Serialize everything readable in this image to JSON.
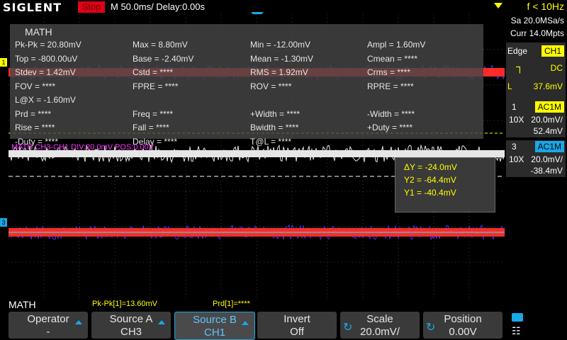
{
  "header": {
    "logo": "SIGLENT",
    "run_state": "Stop",
    "timebase": "M 50.0ms/ Delay:0.00s",
    "trigger_freq": "f < 10Hz"
  },
  "acquisition": {
    "sample_rate": "Sa 20.0MSa/s",
    "memory": "Curr 14.0Mpts"
  },
  "trigger": {
    "type": "Edge",
    "source": "CH1",
    "coupling": "DC",
    "slope_label": "L",
    "level": "37.6mV"
  },
  "channels": [
    {
      "num": "1",
      "coupling": "AC1M",
      "probe": "10X",
      "scale": "20.0mV/",
      "offset": "52.4mV",
      "color": "#ffff00"
    },
    {
      "num": "3",
      "coupling": "AC1M",
      "probe": "10X",
      "scale": "20.0mV/",
      "offset": "-38.4mV",
      "color": "#ff33ff"
    }
  ],
  "math": {
    "title": "MATH",
    "trace_label": "MATH  CH3-CH1  DIV:20.0mV  POS:0.00V",
    "measurements": [
      [
        "Pk-Pk = 20.80mV",
        "Max = 8.80mV",
        "Min = -12.00mV",
        "Ampl = 1.60mV"
      ],
      [
        "Top = -800.00uV",
        "Base = -2.40mV",
        "Mean = -1.30mV",
        "Cmean = ****"
      ],
      [
        "Stdev = 1.42mV",
        "Cstd = ****",
        "RMS = 1.92mV",
        "Crms = ****"
      ],
      [
        "FOV = ****",
        "FPRE = ****",
        "ROV = ****",
        "RPRE = ****"
      ],
      [
        "L@X = -1.60mV",
        "",
        "",
        ""
      ],
      [
        "Prd = ****",
        "Freq = ****",
        "+Width = ****",
        "-Width = ****"
      ],
      [
        "Rise = ****",
        "Fall = ****",
        "Bwidth = ****",
        "+Duty = ****"
      ],
      [
        "-Duty = ****",
        "Delay = ****",
        "T@L = ****",
        ""
      ]
    ]
  },
  "cursors": {
    "delta_y": "ΔY = -24.0mV",
    "y2": "Y2 = -64.4mV",
    "y1": "Y1 = -40.4mV"
  },
  "status_line": {
    "menu": "MATH",
    "pkpk": "Pk-Pk[1]=13.60mV",
    "prd": "Prd[1]=****"
  },
  "softkeys": [
    {
      "label": "Operator",
      "value": "-"
    },
    {
      "label": "Source A",
      "value": "CH3"
    },
    {
      "label": "Source B",
      "value": "CH1"
    },
    {
      "label": "Invert",
      "value": "Off"
    },
    {
      "label": "Scale",
      "value": "20.0mV/"
    },
    {
      "label": "Position",
      "value": "0.00V"
    }
  ],
  "icons": {
    "knob": "rotate-knob-icon",
    "usb": "usb-icon",
    "network": "network-icon"
  }
}
